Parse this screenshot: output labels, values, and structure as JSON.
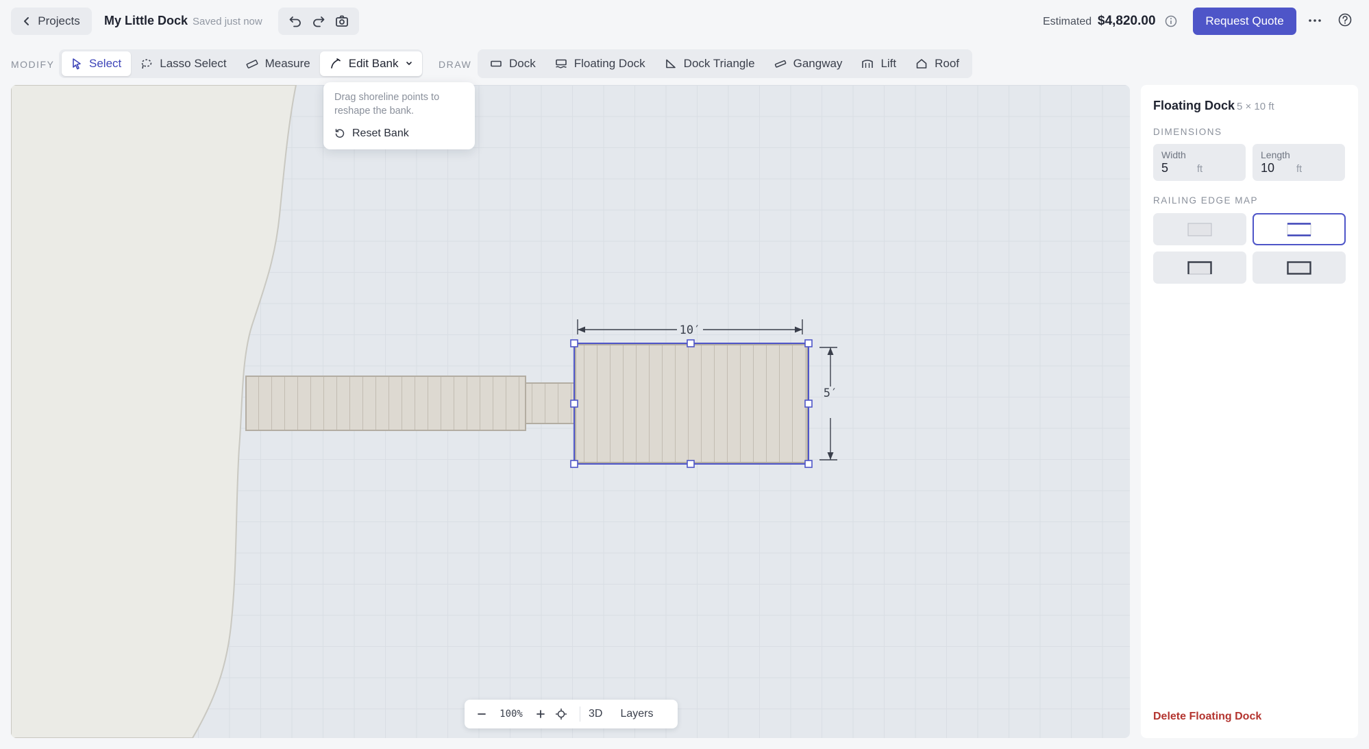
{
  "header": {
    "back_label": "Projects",
    "project_title": "My Little Dock",
    "save_status": "Saved just now",
    "estimate_label": "Estimated",
    "estimate_value": "$4,820.00",
    "request_quote_label": "Request Quote"
  },
  "toolbar": {
    "modify_label": "MODIFY",
    "draw_label": "DRAW",
    "modify_tools": [
      "Select",
      "Lasso Select",
      "Measure",
      "Edit Bank"
    ],
    "draw_tools": [
      "Dock",
      "Floating Dock",
      "Dock Triangle",
      "Gangway",
      "Lift",
      "Roof"
    ],
    "active_tool": "Select"
  },
  "bank_menu": {
    "hint": "Drag shoreline points to reshape the bank.",
    "reset_label": "Reset Bank"
  },
  "canvas": {
    "dim_length_label": "10′",
    "dim_width_label": "5′"
  },
  "zoom": {
    "level": "100%",
    "three_d_label": "3D",
    "layers_label": "Layers"
  },
  "panel": {
    "title": "Floating Dock",
    "size": "5 × 10 ft",
    "dimensions_label": "DIMENSIONS",
    "width_label": "Width",
    "width_value": "5",
    "length_label": "Length",
    "length_value": "10",
    "unit": "ft",
    "railing_label": "RAILING EDGE MAP",
    "selected_railing": "sides",
    "delete_label": "Delete Floating Dock"
  },
  "colors": {
    "accent": "#4e55c8",
    "danger": "#b3342f",
    "deck": "#ddd9d1",
    "land": "#ebebe6",
    "water": "#e4e8ed"
  }
}
